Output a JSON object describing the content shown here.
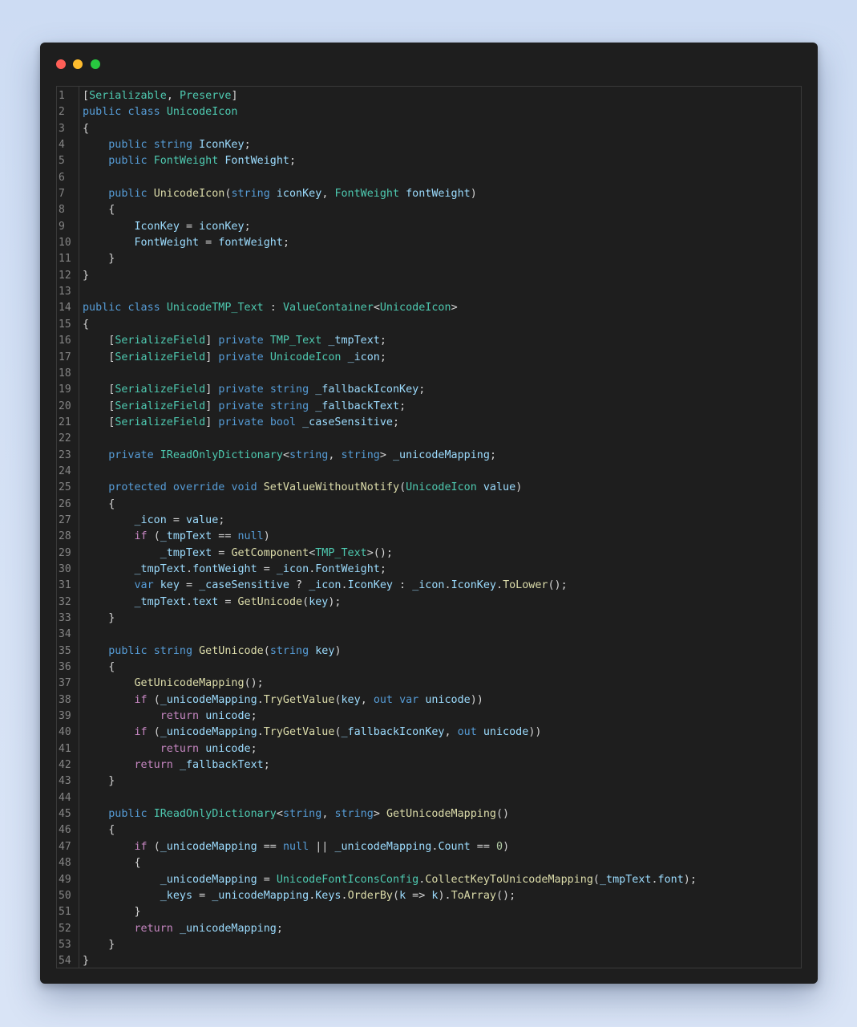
{
  "window": {
    "controls": [
      "close",
      "minimize",
      "maximize"
    ]
  },
  "editor": {
    "lines": [
      [
        {
          "t": "[",
          "c": "p"
        },
        {
          "t": "Serializable",
          "c": "t"
        },
        {
          "t": ", ",
          "c": "p"
        },
        {
          "t": "Preserve",
          "c": "t"
        },
        {
          "t": "]",
          "c": "p"
        }
      ],
      [
        {
          "t": "public ",
          "c": "k"
        },
        {
          "t": "class ",
          "c": "k"
        },
        {
          "t": "UnicodeIcon",
          "c": "t"
        }
      ],
      [
        {
          "t": "{",
          "c": "p"
        }
      ],
      [
        {
          "t": "    ",
          "c": "p"
        },
        {
          "t": "public ",
          "c": "k"
        },
        {
          "t": "string ",
          "c": "k"
        },
        {
          "t": "IconKey",
          "c": "v"
        },
        {
          "t": ";",
          "c": "p"
        }
      ],
      [
        {
          "t": "    ",
          "c": "p"
        },
        {
          "t": "public ",
          "c": "k"
        },
        {
          "t": "FontWeight ",
          "c": "t"
        },
        {
          "t": "FontWeight",
          "c": "v"
        },
        {
          "t": ";",
          "c": "p"
        }
      ],
      [],
      [
        {
          "t": "    ",
          "c": "p"
        },
        {
          "t": "public ",
          "c": "k"
        },
        {
          "t": "UnicodeIcon",
          "c": "f"
        },
        {
          "t": "(",
          "c": "p"
        },
        {
          "t": "string ",
          "c": "k"
        },
        {
          "t": "iconKey",
          "c": "v"
        },
        {
          "t": ", ",
          "c": "p"
        },
        {
          "t": "FontWeight ",
          "c": "t"
        },
        {
          "t": "fontWeight",
          "c": "v"
        },
        {
          "t": ")",
          "c": "p"
        }
      ],
      [
        {
          "t": "    {",
          "c": "p"
        }
      ],
      [
        {
          "t": "        ",
          "c": "p"
        },
        {
          "t": "IconKey",
          "c": "v"
        },
        {
          "t": " = ",
          "c": "p"
        },
        {
          "t": "iconKey",
          "c": "v"
        },
        {
          "t": ";",
          "c": "p"
        }
      ],
      [
        {
          "t": "        ",
          "c": "p"
        },
        {
          "t": "FontWeight",
          "c": "v"
        },
        {
          "t": " = ",
          "c": "p"
        },
        {
          "t": "fontWeight",
          "c": "v"
        },
        {
          "t": ";",
          "c": "p"
        }
      ],
      [
        {
          "t": "    }",
          "c": "p"
        }
      ],
      [
        {
          "t": "}",
          "c": "p"
        }
      ],
      [],
      [
        {
          "t": "public ",
          "c": "k"
        },
        {
          "t": "class ",
          "c": "k"
        },
        {
          "t": "UnicodeTMP_Text",
          "c": "t"
        },
        {
          "t": " : ",
          "c": "p"
        },
        {
          "t": "ValueContainer",
          "c": "t"
        },
        {
          "t": "<",
          "c": "p"
        },
        {
          "t": "UnicodeIcon",
          "c": "t"
        },
        {
          "t": ">",
          "c": "p"
        }
      ],
      [
        {
          "t": "{",
          "c": "p"
        }
      ],
      [
        {
          "t": "    [",
          "c": "p"
        },
        {
          "t": "SerializeField",
          "c": "t"
        },
        {
          "t": "] ",
          "c": "p"
        },
        {
          "t": "private ",
          "c": "k"
        },
        {
          "t": "TMP_Text ",
          "c": "t"
        },
        {
          "t": "_tmpText",
          "c": "v"
        },
        {
          "t": ";",
          "c": "p"
        }
      ],
      [
        {
          "t": "    [",
          "c": "p"
        },
        {
          "t": "SerializeField",
          "c": "t"
        },
        {
          "t": "] ",
          "c": "p"
        },
        {
          "t": "private ",
          "c": "k"
        },
        {
          "t": "UnicodeIcon ",
          "c": "t"
        },
        {
          "t": "_icon",
          "c": "v"
        },
        {
          "t": ";",
          "c": "p"
        }
      ],
      [],
      [
        {
          "t": "    [",
          "c": "p"
        },
        {
          "t": "SerializeField",
          "c": "t"
        },
        {
          "t": "] ",
          "c": "p"
        },
        {
          "t": "private ",
          "c": "k"
        },
        {
          "t": "string ",
          "c": "k"
        },
        {
          "t": "_fallbackIconKey",
          "c": "v"
        },
        {
          "t": ";",
          "c": "p"
        }
      ],
      [
        {
          "t": "    [",
          "c": "p"
        },
        {
          "t": "SerializeField",
          "c": "t"
        },
        {
          "t": "] ",
          "c": "p"
        },
        {
          "t": "private ",
          "c": "k"
        },
        {
          "t": "string ",
          "c": "k"
        },
        {
          "t": "_fallbackText",
          "c": "v"
        },
        {
          "t": ";",
          "c": "p"
        }
      ],
      [
        {
          "t": "    [",
          "c": "p"
        },
        {
          "t": "SerializeField",
          "c": "t"
        },
        {
          "t": "] ",
          "c": "p"
        },
        {
          "t": "private ",
          "c": "k"
        },
        {
          "t": "bool ",
          "c": "k"
        },
        {
          "t": "_caseSensitive",
          "c": "v"
        },
        {
          "t": ";",
          "c": "p"
        }
      ],
      [],
      [
        {
          "t": "    ",
          "c": "p"
        },
        {
          "t": "private ",
          "c": "k"
        },
        {
          "t": "IReadOnlyDictionary",
          "c": "t"
        },
        {
          "t": "<",
          "c": "p"
        },
        {
          "t": "string",
          "c": "k"
        },
        {
          "t": ", ",
          "c": "p"
        },
        {
          "t": "string",
          "c": "k"
        },
        {
          "t": "> ",
          "c": "p"
        },
        {
          "t": "_unicodeMapping",
          "c": "v"
        },
        {
          "t": ";",
          "c": "p"
        }
      ],
      [],
      [
        {
          "t": "    ",
          "c": "p"
        },
        {
          "t": "protected ",
          "c": "k"
        },
        {
          "t": "override ",
          "c": "k"
        },
        {
          "t": "void ",
          "c": "k"
        },
        {
          "t": "SetValueWithoutNotify",
          "c": "f"
        },
        {
          "t": "(",
          "c": "p"
        },
        {
          "t": "UnicodeIcon ",
          "c": "t"
        },
        {
          "t": "value",
          "c": "v"
        },
        {
          "t": ")",
          "c": "p"
        }
      ],
      [
        {
          "t": "    {",
          "c": "p"
        }
      ],
      [
        {
          "t": "        ",
          "c": "p"
        },
        {
          "t": "_icon",
          "c": "v"
        },
        {
          "t": " = ",
          "c": "p"
        },
        {
          "t": "value",
          "c": "v"
        },
        {
          "t": ";",
          "c": "p"
        }
      ],
      [
        {
          "t": "        ",
          "c": "p"
        },
        {
          "t": "if ",
          "c": "c"
        },
        {
          "t": "(",
          "c": "p"
        },
        {
          "t": "_tmpText",
          "c": "v"
        },
        {
          "t": " == ",
          "c": "p"
        },
        {
          "t": "null",
          "c": "k"
        },
        {
          "t": ")",
          "c": "p"
        }
      ],
      [
        {
          "t": "            ",
          "c": "p"
        },
        {
          "t": "_tmpText",
          "c": "v"
        },
        {
          "t": " = ",
          "c": "p"
        },
        {
          "t": "GetComponent",
          "c": "f"
        },
        {
          "t": "<",
          "c": "p"
        },
        {
          "t": "TMP_Text",
          "c": "t"
        },
        {
          "t": ">();",
          "c": "p"
        }
      ],
      [
        {
          "t": "        ",
          "c": "p"
        },
        {
          "t": "_tmpText",
          "c": "v"
        },
        {
          "t": ".",
          "c": "p"
        },
        {
          "t": "fontWeight",
          "c": "v"
        },
        {
          "t": " = ",
          "c": "p"
        },
        {
          "t": "_icon",
          "c": "v"
        },
        {
          "t": ".",
          "c": "p"
        },
        {
          "t": "FontWeight",
          "c": "v"
        },
        {
          "t": ";",
          "c": "p"
        }
      ],
      [
        {
          "t": "        ",
          "c": "p"
        },
        {
          "t": "var ",
          "c": "k"
        },
        {
          "t": "key",
          "c": "v"
        },
        {
          "t": " = ",
          "c": "p"
        },
        {
          "t": "_caseSensitive",
          "c": "v"
        },
        {
          "t": " ? ",
          "c": "p"
        },
        {
          "t": "_icon",
          "c": "v"
        },
        {
          "t": ".",
          "c": "p"
        },
        {
          "t": "IconKey",
          "c": "v"
        },
        {
          "t": " : ",
          "c": "p"
        },
        {
          "t": "_icon",
          "c": "v"
        },
        {
          "t": ".",
          "c": "p"
        },
        {
          "t": "IconKey",
          "c": "v"
        },
        {
          "t": ".",
          "c": "p"
        },
        {
          "t": "ToLower",
          "c": "f"
        },
        {
          "t": "();",
          "c": "p"
        }
      ],
      [
        {
          "t": "        ",
          "c": "p"
        },
        {
          "t": "_tmpText",
          "c": "v"
        },
        {
          "t": ".",
          "c": "p"
        },
        {
          "t": "text",
          "c": "v"
        },
        {
          "t": " = ",
          "c": "p"
        },
        {
          "t": "GetUnicode",
          "c": "f"
        },
        {
          "t": "(",
          "c": "p"
        },
        {
          "t": "key",
          "c": "v"
        },
        {
          "t": ");",
          "c": "p"
        }
      ],
      [
        {
          "t": "    }",
          "c": "p"
        }
      ],
      [],
      [
        {
          "t": "    ",
          "c": "p"
        },
        {
          "t": "public ",
          "c": "k"
        },
        {
          "t": "string ",
          "c": "k"
        },
        {
          "t": "GetUnicode",
          "c": "f"
        },
        {
          "t": "(",
          "c": "p"
        },
        {
          "t": "string ",
          "c": "k"
        },
        {
          "t": "key",
          "c": "v"
        },
        {
          "t": ")",
          "c": "p"
        }
      ],
      [
        {
          "t": "    {",
          "c": "p"
        }
      ],
      [
        {
          "t": "        ",
          "c": "p"
        },
        {
          "t": "GetUnicodeMapping",
          "c": "f"
        },
        {
          "t": "();",
          "c": "p"
        }
      ],
      [
        {
          "t": "        ",
          "c": "p"
        },
        {
          "t": "if ",
          "c": "c"
        },
        {
          "t": "(",
          "c": "p"
        },
        {
          "t": "_unicodeMapping",
          "c": "v"
        },
        {
          "t": ".",
          "c": "p"
        },
        {
          "t": "TryGetValue",
          "c": "f"
        },
        {
          "t": "(",
          "c": "p"
        },
        {
          "t": "key",
          "c": "v"
        },
        {
          "t": ", ",
          "c": "p"
        },
        {
          "t": "out ",
          "c": "k"
        },
        {
          "t": "var ",
          "c": "k"
        },
        {
          "t": "unicode",
          "c": "v"
        },
        {
          "t": "))",
          "c": "p"
        }
      ],
      [
        {
          "t": "            ",
          "c": "p"
        },
        {
          "t": "return ",
          "c": "c"
        },
        {
          "t": "unicode",
          "c": "v"
        },
        {
          "t": ";",
          "c": "p"
        }
      ],
      [
        {
          "t": "        ",
          "c": "p"
        },
        {
          "t": "if ",
          "c": "c"
        },
        {
          "t": "(",
          "c": "p"
        },
        {
          "t": "_unicodeMapping",
          "c": "v"
        },
        {
          "t": ".",
          "c": "p"
        },
        {
          "t": "TryGetValue",
          "c": "f"
        },
        {
          "t": "(",
          "c": "p"
        },
        {
          "t": "_fallbackIconKey",
          "c": "v"
        },
        {
          "t": ", ",
          "c": "p"
        },
        {
          "t": "out ",
          "c": "k"
        },
        {
          "t": "unicode",
          "c": "v"
        },
        {
          "t": "))",
          "c": "p"
        }
      ],
      [
        {
          "t": "            ",
          "c": "p"
        },
        {
          "t": "return ",
          "c": "c"
        },
        {
          "t": "unicode",
          "c": "v"
        },
        {
          "t": ";",
          "c": "p"
        }
      ],
      [
        {
          "t": "        ",
          "c": "p"
        },
        {
          "t": "return ",
          "c": "c"
        },
        {
          "t": "_fallbackText",
          "c": "v"
        },
        {
          "t": ";",
          "c": "p"
        }
      ],
      [
        {
          "t": "    }",
          "c": "p"
        }
      ],
      [],
      [
        {
          "t": "    ",
          "c": "p"
        },
        {
          "t": "public ",
          "c": "k"
        },
        {
          "t": "IReadOnlyDictionary",
          "c": "t"
        },
        {
          "t": "<",
          "c": "p"
        },
        {
          "t": "string",
          "c": "k"
        },
        {
          "t": ", ",
          "c": "p"
        },
        {
          "t": "string",
          "c": "k"
        },
        {
          "t": "> ",
          "c": "p"
        },
        {
          "t": "GetUnicodeMapping",
          "c": "f"
        },
        {
          "t": "()",
          "c": "p"
        }
      ],
      [
        {
          "t": "    {",
          "c": "p"
        }
      ],
      [
        {
          "t": "        ",
          "c": "p"
        },
        {
          "t": "if ",
          "c": "c"
        },
        {
          "t": "(",
          "c": "p"
        },
        {
          "t": "_unicodeMapping",
          "c": "v"
        },
        {
          "t": " == ",
          "c": "p"
        },
        {
          "t": "null",
          "c": "k"
        },
        {
          "t": " || ",
          "c": "p"
        },
        {
          "t": "_unicodeMapping",
          "c": "v"
        },
        {
          "t": ".",
          "c": "p"
        },
        {
          "t": "Count",
          "c": "v"
        },
        {
          "t": " == ",
          "c": "p"
        },
        {
          "t": "0",
          "c": "n"
        },
        {
          "t": ")",
          "c": "p"
        }
      ],
      [
        {
          "t": "        {",
          "c": "p"
        }
      ],
      [
        {
          "t": "            ",
          "c": "p"
        },
        {
          "t": "_unicodeMapping",
          "c": "v"
        },
        {
          "t": " = ",
          "c": "p"
        },
        {
          "t": "UnicodeFontIconsConfig",
          "c": "t"
        },
        {
          "t": ".",
          "c": "p"
        },
        {
          "t": "CollectKeyToUnicodeMapping",
          "c": "f"
        },
        {
          "t": "(",
          "c": "p"
        },
        {
          "t": "_tmpText",
          "c": "v"
        },
        {
          "t": ".",
          "c": "p"
        },
        {
          "t": "font",
          "c": "v"
        },
        {
          "t": ");",
          "c": "p"
        }
      ],
      [
        {
          "t": "            ",
          "c": "p"
        },
        {
          "t": "_keys",
          "c": "v"
        },
        {
          "t": " = ",
          "c": "p"
        },
        {
          "t": "_unicodeMapping",
          "c": "v"
        },
        {
          "t": ".",
          "c": "p"
        },
        {
          "t": "Keys",
          "c": "v"
        },
        {
          "t": ".",
          "c": "p"
        },
        {
          "t": "OrderBy",
          "c": "f"
        },
        {
          "t": "(",
          "c": "p"
        },
        {
          "t": "k",
          "c": "v"
        },
        {
          "t": " => ",
          "c": "p"
        },
        {
          "t": "k",
          "c": "v"
        },
        {
          "t": ").",
          "c": "p"
        },
        {
          "t": "ToArray",
          "c": "f"
        },
        {
          "t": "();",
          "c": "p"
        }
      ],
      [
        {
          "t": "        }",
          "c": "p"
        }
      ],
      [
        {
          "t": "        ",
          "c": "p"
        },
        {
          "t": "return ",
          "c": "c"
        },
        {
          "t": "_unicodeMapping",
          "c": "v"
        },
        {
          "t": ";",
          "c": "p"
        }
      ],
      [
        {
          "t": "    }",
          "c": "p"
        }
      ],
      [
        {
          "t": "}",
          "c": "p"
        }
      ]
    ]
  },
  "colors": {
    "background": "#d6e2f5",
    "window": "#1e1e1e",
    "keyword": "#569cd6",
    "type": "#4ec9b0",
    "function": "#dcdcaa",
    "variable": "#9cdcfe",
    "control": "#c586c0",
    "number": "#b5cea8",
    "text": "#d4d4d4",
    "line_number": "#858585"
  }
}
